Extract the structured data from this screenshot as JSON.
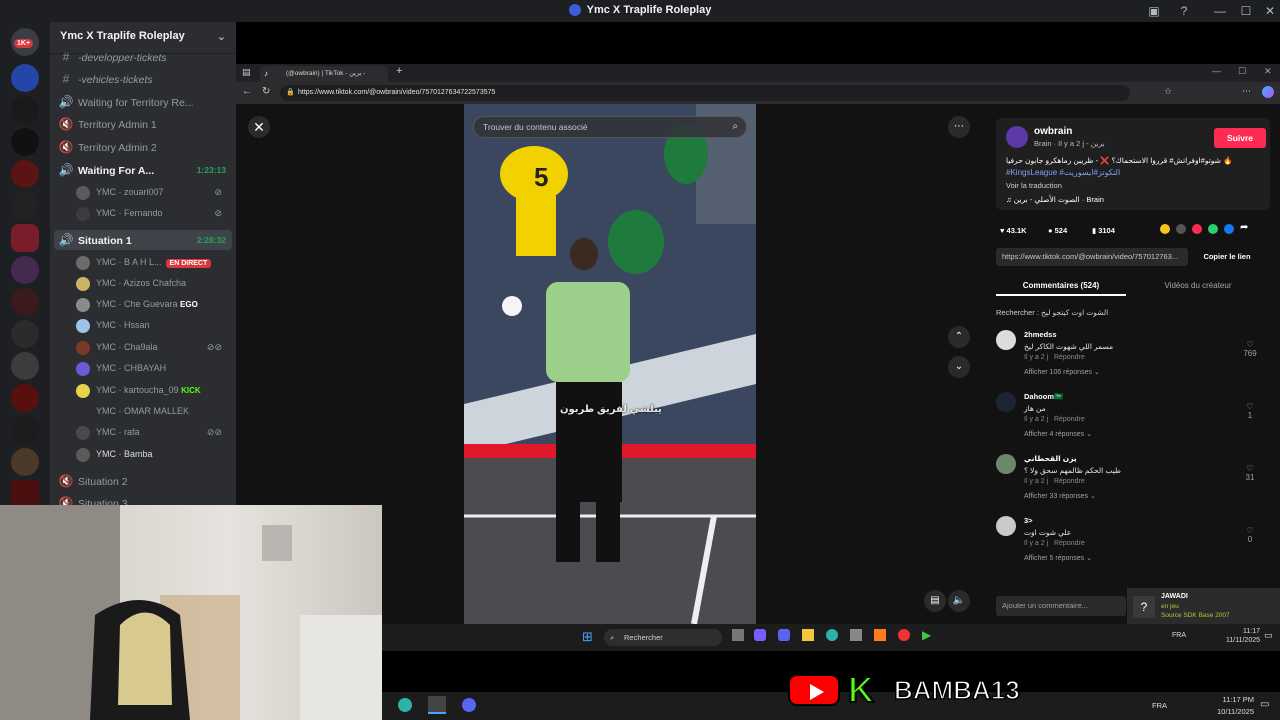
{
  "window": {
    "title": "Ymc X Traplife Roleplay"
  },
  "rail": {
    "badge": "1K+"
  },
  "server": {
    "name": "Ymc X Traplife Roleplay"
  },
  "channels": [
    {
      "label": "-developper-tickets",
      "icon": "hash-icon"
    },
    {
      "label": "-vehicles-tickets",
      "icon": "hash-icon"
    },
    {
      "label": "Waiting for Territory Re...",
      "icon": "speaker-icon"
    },
    {
      "label": "Territory Admin 1",
      "icon": "speaker-icon"
    },
    {
      "label": "Territory Admin 2",
      "icon": "speaker-icon"
    },
    {
      "label": "Waiting For A...",
      "icon": "speaker-icon",
      "timer": "1:23:13"
    },
    {
      "label": "Situation 1",
      "icon": "speaker-icon",
      "timer": "2:28:32"
    },
    {
      "label": "Situation 2",
      "icon": "speaker-icon"
    },
    {
      "label": "Situation 3",
      "icon": "speaker-icon"
    }
  ],
  "waiting_users": [
    {
      "name": "YMC · zouari007"
    },
    {
      "name": "YMC · Fernando"
    }
  ],
  "situation_users": [
    {
      "name": "YMC · B A H L...",
      "badge": "EN DIRECT"
    },
    {
      "name": "YMC · Azizos Chafcha"
    },
    {
      "name": "YMC · Che Guevara",
      "tag": "EGO"
    },
    {
      "name": "YMC · Hssan"
    },
    {
      "name": "YMC · Cha9ala"
    },
    {
      "name": "YMC · CHBAYAH"
    },
    {
      "name": "YMC · kartoucha_09",
      "tag": "KICK"
    },
    {
      "name": "YMC · OMAR MALLEK"
    },
    {
      "name": "YMC · rafa"
    },
    {
      "name": "YMC · Bamba"
    }
  ],
  "browser": {
    "tab_title": "(@owbrain) | TikTok - برين -",
    "url": "https://www.tiktok.com/@owbrain/video/7570127634722573575"
  },
  "tiktok": {
    "search_placeholder": "Trouver du contenu associé",
    "video_caption": "يبلشي لفريق طربون",
    "creator": {
      "handle": "owbrain",
      "sub": "Brain · Il y a 2 j - برين",
      "follow": "Suivre",
      "caption": "شوتو#اوفراتش# قرروا الاستحماك؟ ❌ - ظريبن رماهكرو جابون حرفيا 🔥",
      "hashtags": "#KingsLeague #التكوتز#ايسوريت",
      "translate": "Voir la traduction",
      "sound": "الصوت الأصلي - برين · Brain"
    },
    "stats": {
      "likes": "43.1K",
      "comments": "524",
      "saves": "3104"
    },
    "share_link": "https://www.tiktok.com/@owbrain/video/757012763...",
    "copy_link": "Copier le lien",
    "tabs": {
      "comments": "Commentaires (524)",
      "creator_videos": "Vidéos du créateur"
    },
    "search_comments": "Rechercher : الشوت اوت كيتجو ليخ",
    "comments": [
      {
        "user": "2hmedss",
        "text": "مسمر اللي شهوت الكاكر ليخ",
        "meta": "Il y a 2 j",
        "reply": "Répondre",
        "more": "Afficher 106 réponses",
        "likes": "769"
      },
      {
        "user": "Dahoom🇸🇦",
        "text": "من هاز",
        "meta": "Il y a 2 j",
        "reply": "Répondre",
        "more": "Afficher 4 réponses",
        "likes": "1"
      },
      {
        "user": "يزن القحطاني",
        "text": "طيب الحكم ظالمهم سحق ولا ؟",
        "meta": "Il y a 2 j",
        "reply": "Répondre",
        "more": "Afficher 33 réponses",
        "likes": "31"
      },
      {
        "user": "3>",
        "text": "علي شوت اوت",
        "meta": "Il y a 2 j",
        "reply": "Répondre",
        "more": "Afficher 5 réponses",
        "likes": "0"
      }
    ],
    "add_comment": "Ajouter un commentaire..."
  },
  "inner_taskbar": {
    "search": "Rechercher",
    "lang": "FRA",
    "time": "11:17",
    "date": "11/11/2025"
  },
  "notification": {
    "title": "JAWADI",
    "status": "en jeu",
    "source": "Source SDK Base 2007"
  },
  "outer_taskbar": {
    "lang": "FRA",
    "time": "11:17 PM",
    "date": "10/11/2025"
  },
  "overlay": {
    "name": "BAMBA13"
  }
}
